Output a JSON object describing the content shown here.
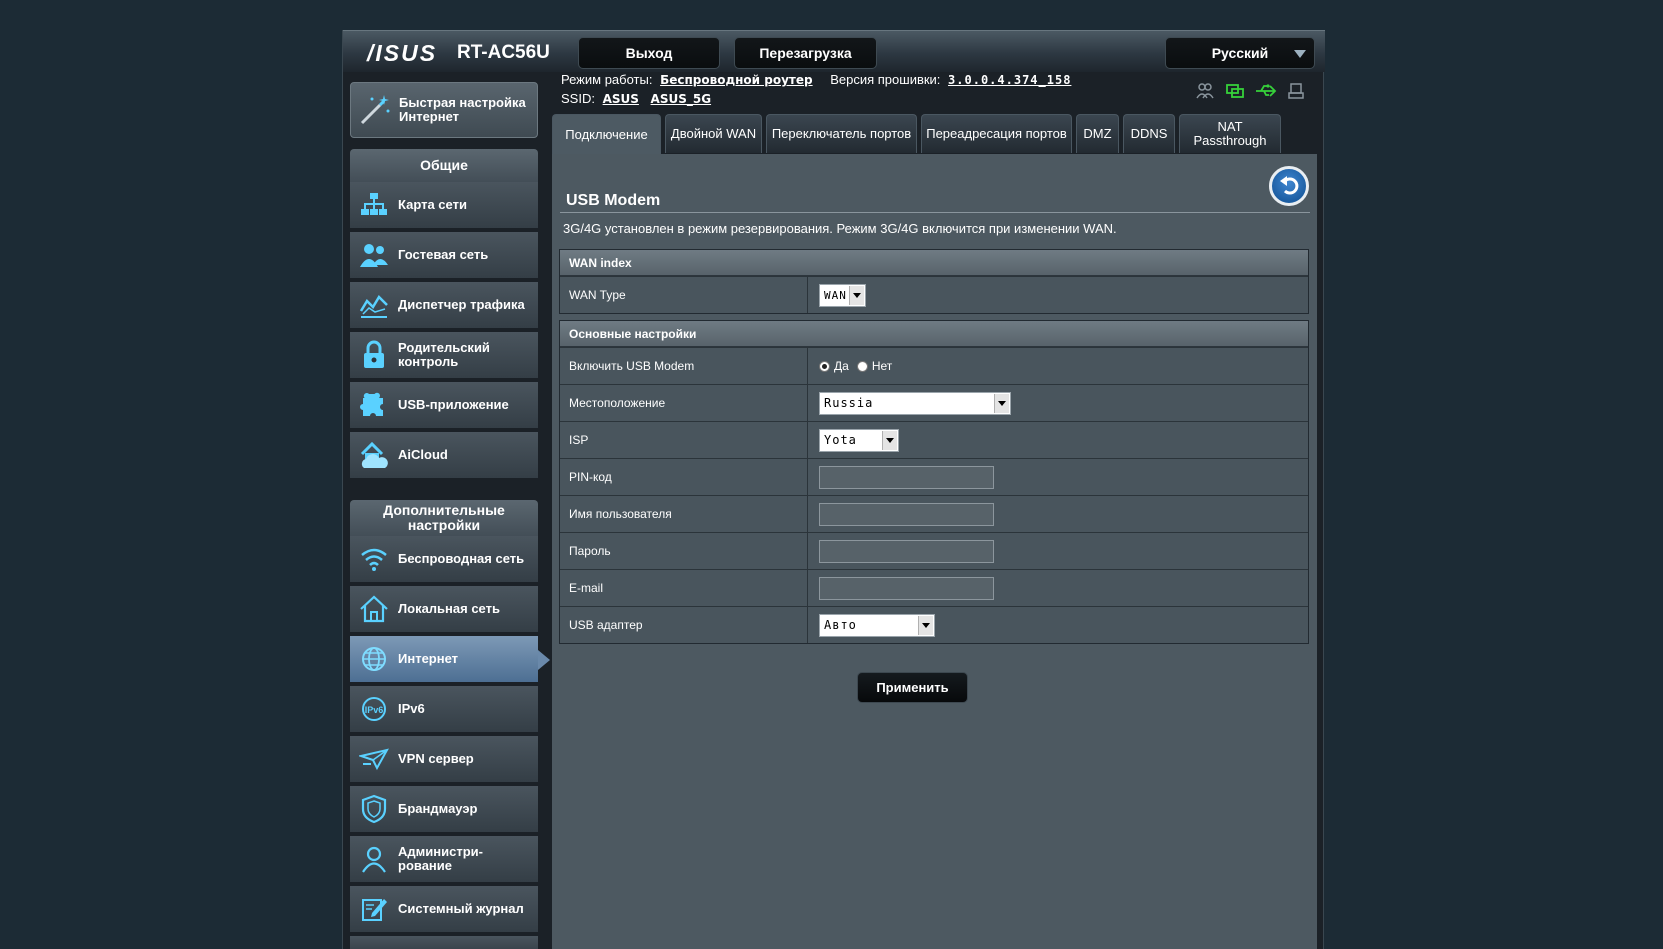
{
  "header": {
    "logo": "/ISUS",
    "model": "RT-AC56U",
    "logout_label": "Выход",
    "reboot_label": "Перезагрузка",
    "language": "Русский"
  },
  "status": {
    "mode_label": "Режим работы:",
    "mode_value": "Беспроводной роутер",
    "firmware_label": "Версия прошивки:",
    "firmware_value": "3.0.0.4.374_158",
    "ssid_label": "SSID:",
    "ssid_values": [
      "ASUS",
      "ASUS_5G"
    ]
  },
  "sidebar": {
    "quick_setup": "Быстрая настройка Интернет",
    "general_title": "Общие",
    "general_items": [
      {
        "label": "Карта сети",
        "icon": "network-map-icon"
      },
      {
        "label": "Гостевая сеть",
        "icon": "guest-network-icon"
      },
      {
        "label": "Диспетчер трафика",
        "icon": "traffic-manager-icon"
      },
      {
        "label": "Родительский контроль",
        "icon": "parental-control-icon"
      },
      {
        "label": "USB-приложение",
        "icon": "usb-app-icon"
      },
      {
        "label": "AiCloud",
        "icon": "aicloud-icon"
      }
    ],
    "advanced_title": "Дополнительные настройки",
    "advanced_items": [
      {
        "label": "Беспроводная сеть",
        "icon": "wireless-icon"
      },
      {
        "label": "Локальная сеть",
        "icon": "lan-icon"
      },
      {
        "label": "Интернет",
        "icon": "internet-icon"
      },
      {
        "label": "IPv6",
        "icon": "ipv6-icon"
      },
      {
        "label": "VPN сервер",
        "icon": "vpn-icon"
      },
      {
        "label": "Брандмауэр",
        "icon": "firewall-icon"
      },
      {
        "label": "Администри-рование",
        "icon": "administration-icon"
      },
      {
        "label": "Системный журнал",
        "icon": "system-log-icon"
      }
    ],
    "active": "Интернет"
  },
  "tabs": [
    {
      "label": "Подключение"
    },
    {
      "label": "Двойной WAN"
    },
    {
      "label": "Переключатель портов"
    },
    {
      "label": "Переадресация портов"
    },
    {
      "label": "DMZ"
    },
    {
      "label": "DDNS"
    },
    {
      "label": "NAT Passthrough"
    }
  ],
  "main": {
    "title": "USB Modem",
    "notice": "3G/4G установлен в режим резервирования. Режим 3G/4G включится при изменении WAN.",
    "wan_index": {
      "heading": "WAN index",
      "wan_type_label": "WAN Type",
      "wan_type_value": "WAN"
    },
    "basic": {
      "heading": "Основные настройки",
      "enable_label": "Включить USB Modem",
      "enable_yes": "Да",
      "enable_no": "Нет",
      "enable_selected": "Да",
      "location_label": "Местоположение",
      "location_value": "Russia",
      "isp_label": "ISP",
      "isp_value": "Yota",
      "pin_label": "PIN-код",
      "pin_value": "",
      "user_label": "Имя пользователя",
      "user_value": "",
      "password_label": "Пароль",
      "password_value": "",
      "email_label": "E-mail",
      "email_value": "",
      "adapter_label": "USB адаптер",
      "adapter_value": "Авто"
    },
    "apply_label": "Применить"
  },
  "colors": {
    "accent_active": "#5f82a6",
    "status_green": "#36d13a",
    "background": "#1c2b35"
  }
}
